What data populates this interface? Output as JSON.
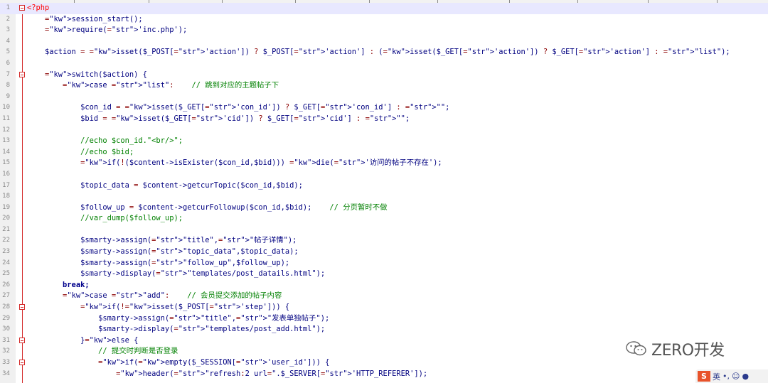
{
  "editor": {
    "lines": [
      {
        "n": "1",
        "indent": "",
        "text": "<?php",
        "kind": "php",
        "fold": true,
        "current": true
      },
      {
        "n": "2",
        "indent": "    ",
        "text": "session_start();"
      },
      {
        "n": "3",
        "indent": "    ",
        "text": "require('inc.php');"
      },
      {
        "n": "4",
        "indent": "",
        "text": ""
      },
      {
        "n": "5",
        "indent": "    ",
        "text": "$action = isset($_POST['action']) ? $_POST['action'] : (isset($_GET['action']) ? $_GET['action'] : \"list\");"
      },
      {
        "n": "6",
        "indent": "",
        "text": ""
      },
      {
        "n": "7",
        "indent": "    ",
        "text": "switch($action) {",
        "fold": true
      },
      {
        "n": "8",
        "indent": "        ",
        "text": "case \"list\":    // 跳到对应的主题帖子下"
      },
      {
        "n": "9",
        "indent": "",
        "text": ""
      },
      {
        "n": "10",
        "indent": "            ",
        "text": "$con_id = isset($_GET['con_id']) ? $_GET['con_id'] : \"\";"
      },
      {
        "n": "11",
        "indent": "            ",
        "text": "$bid = isset($_GET['cid']) ? $_GET['cid'] : \"\";"
      },
      {
        "n": "12",
        "indent": "",
        "text": ""
      },
      {
        "n": "13",
        "indent": "            ",
        "text": "//echo $con_id.\"<br/>\";",
        "kind": "cmt"
      },
      {
        "n": "14",
        "indent": "            ",
        "text": "//echo $bid;",
        "kind": "cmt"
      },
      {
        "n": "15",
        "indent": "            ",
        "text": "if(!($content->isExister($con_id,$bid))) die('访问的帖子不存在');"
      },
      {
        "n": "16",
        "indent": "",
        "text": ""
      },
      {
        "n": "17",
        "indent": "            ",
        "text": "$topic_data = $content->getcurTopic($con_id,$bid);"
      },
      {
        "n": "18",
        "indent": "",
        "text": ""
      },
      {
        "n": "19",
        "indent": "            ",
        "text": "$follow_up = $content->getcurFollowup($con_id,$bid);    // 分页暂时不做"
      },
      {
        "n": "20",
        "indent": "            ",
        "text": "//var_dump($follow_up);",
        "kind": "cmt"
      },
      {
        "n": "21",
        "indent": "",
        "text": ""
      },
      {
        "n": "22",
        "indent": "            ",
        "text": "$smarty->assign(\"title\",\"帖子详情\");"
      },
      {
        "n": "23",
        "indent": "            ",
        "text": "$smarty->assign(\"topic_data\",$topic_data);"
      },
      {
        "n": "24",
        "indent": "            ",
        "text": "$smarty->assign(\"follow_up\",$follow_up);"
      },
      {
        "n": "25",
        "indent": "            ",
        "text": "$smarty->display(\"templates/post_datails.html\");"
      },
      {
        "n": "26",
        "indent": "        ",
        "text": "break;",
        "kind": "kw"
      },
      {
        "n": "27",
        "indent": "        ",
        "text": "case \"add\":    // 会员提交添加的帖子内容"
      },
      {
        "n": "28",
        "indent": "            ",
        "text": "if(!isset($_POST['step'])) {",
        "fold": true
      },
      {
        "n": "29",
        "indent": "                ",
        "text": "$smarty->assign(\"title\",\"发表单独帖子\");"
      },
      {
        "n": "30",
        "indent": "                ",
        "text": "$smarty->display(\"templates/post_add.html\");"
      },
      {
        "n": "31",
        "indent": "            ",
        "text": "}else {",
        "fold": true
      },
      {
        "n": "32",
        "indent": "                ",
        "text": "// 提交时判断是否登录",
        "kind": "cmt"
      },
      {
        "n": "33",
        "indent": "                ",
        "text": "if(empty($_SESSION['user_id'])) {",
        "fold": true
      },
      {
        "n": "34",
        "indent": "                    ",
        "text": "header(\"refresh:2 url=\".$_SERVER['HTTP_REFERER']);"
      }
    ]
  },
  "watermark": {
    "text": "ZERO开发",
    "icon": "wechat-icon"
  },
  "ime": {
    "logo": "S",
    "mode": "英",
    "punct": "•,",
    "icons": [
      "smile-icon",
      "mic-icon"
    ]
  }
}
